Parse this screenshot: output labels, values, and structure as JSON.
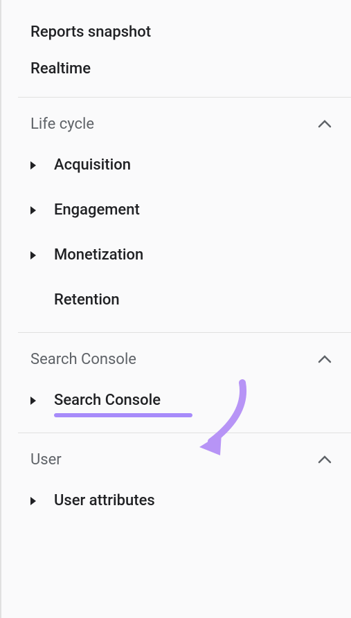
{
  "sidebar": {
    "topItems": [
      {
        "label": "Reports snapshot"
      },
      {
        "label": "Realtime"
      }
    ],
    "sections": [
      {
        "title": "Life cycle",
        "items": [
          {
            "label": "Acquisition",
            "hasChildren": true
          },
          {
            "label": "Engagement",
            "hasChildren": true
          },
          {
            "label": "Monetization",
            "hasChildren": true
          },
          {
            "label": "Retention",
            "hasChildren": false
          }
        ]
      },
      {
        "title": "Search Console",
        "items": [
          {
            "label": "Search Console",
            "hasChildren": true,
            "highlighted": true
          }
        ]
      },
      {
        "title": "User",
        "items": [
          {
            "label": "User attributes",
            "hasChildren": true
          }
        ]
      }
    ]
  }
}
